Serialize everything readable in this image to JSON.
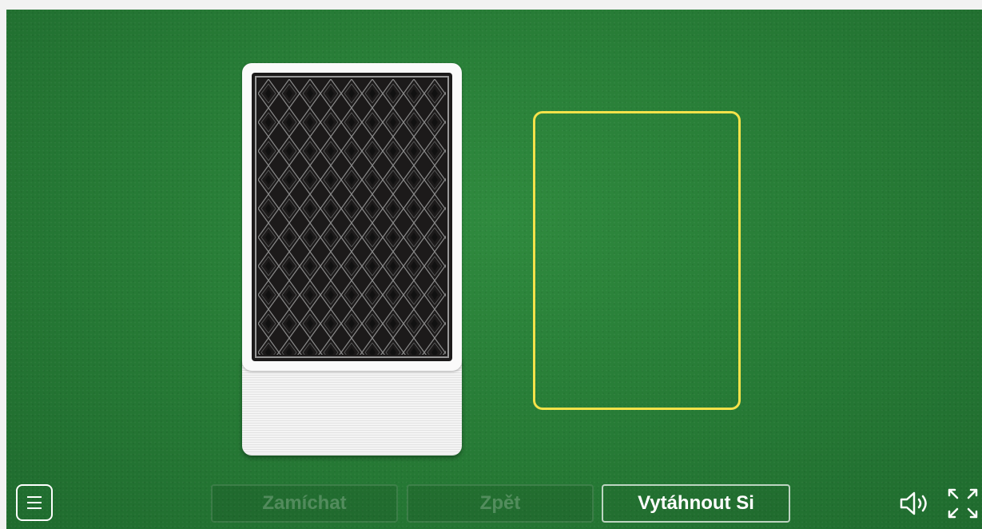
{
  "controls": {
    "shuffle_label": "Zamíchat",
    "undo_label": "Zpět",
    "draw_label": "Vytáhnout Si"
  },
  "icons": {
    "menu": "hamburger-icon",
    "sound": "speaker-icon",
    "fullscreen": "fullscreen-icon"
  },
  "colors": {
    "felt": "#267a35",
    "slot_outline": "#f5e24a",
    "card_back": "#1c1a1a"
  }
}
